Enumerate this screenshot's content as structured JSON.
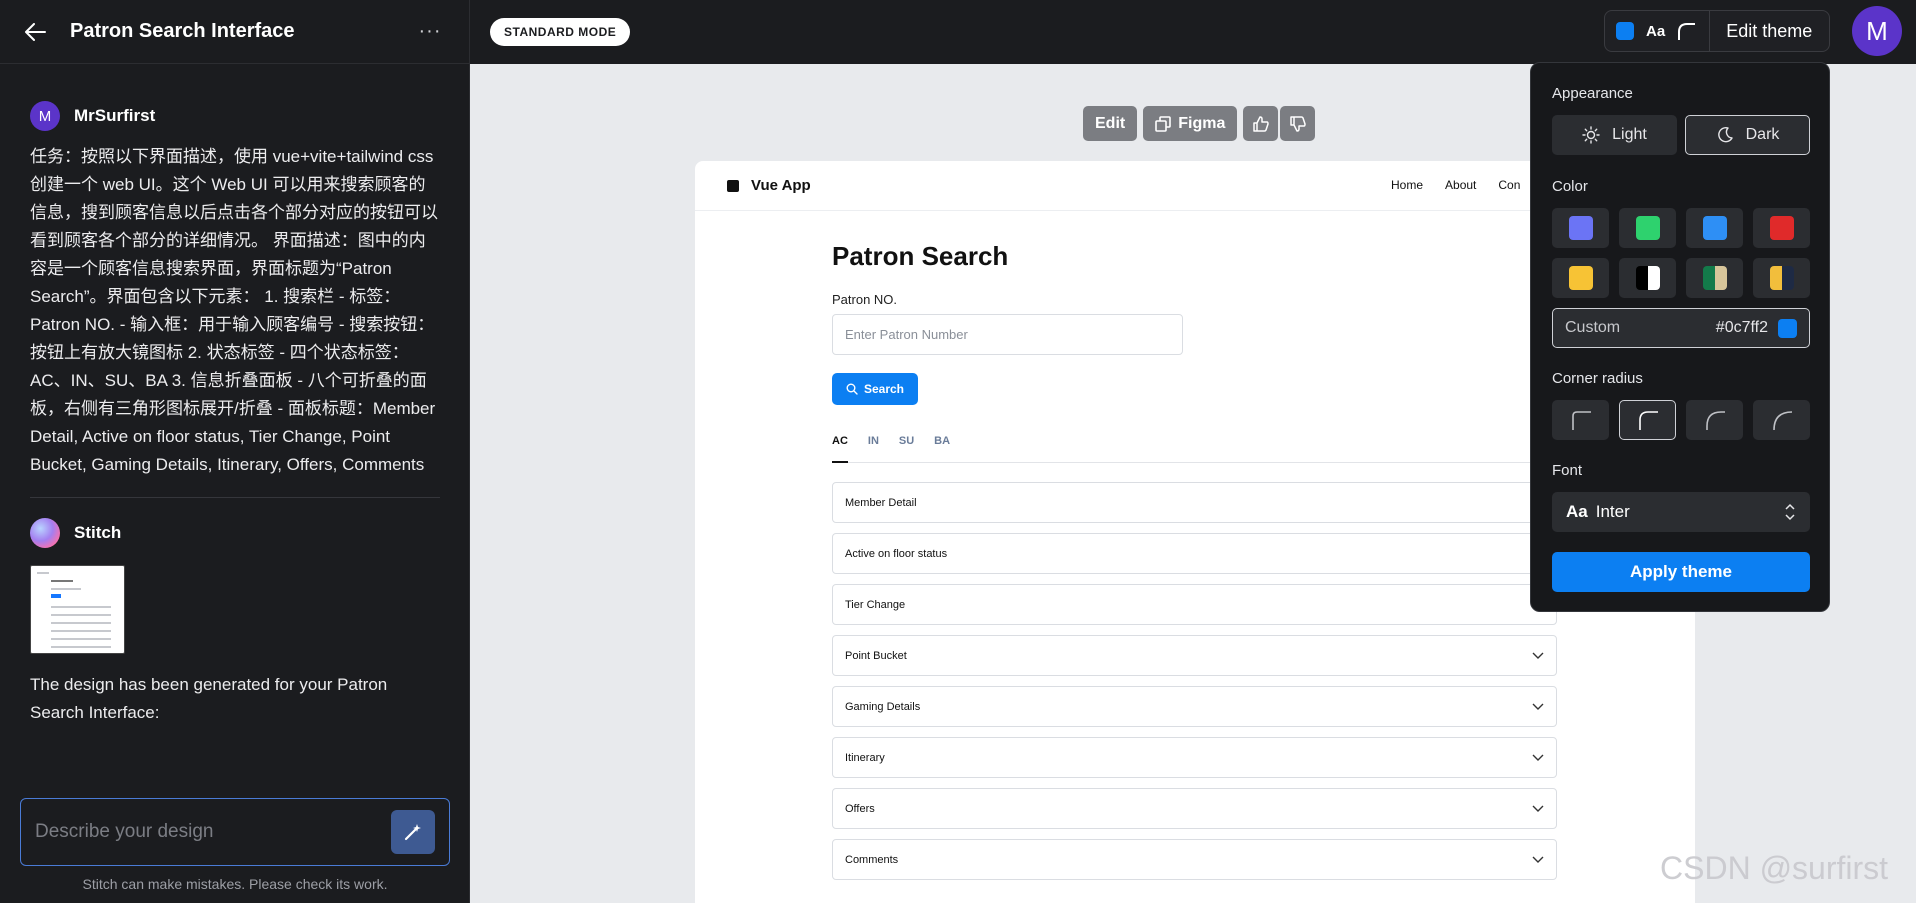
{
  "left_panel": {
    "title": "Patron Search Interface",
    "user": {
      "avatar_letter": "M",
      "name": "MrSurfirst"
    },
    "user_message": "任务：按照以下界面描述，使用 vue+vite+tailwind css 创建一个 web UI。这个 Web UI 可以用来搜索顾客的信息，搜到顾客信息以后点击各个部分对应的按钮可以看到顾客各个部分的详细情况。 界面描述：图中的内容是一个顾客信息搜索界面，界面标题为“Patron Search”。界面包含以下元素： 1. 搜索栏 - 标签：Patron NO. - 输入框：用于输入顾客编号 - 搜索按钮：按钮上有放大镜图标 2. 状态标签 - 四个状态标签：AC、IN、SU、BA 3. 信息折叠面板 - 八个可折叠的面板，右侧有三角形图标展开/折叠 - 面板标题：Member Detail, Active on floor status, Tier Change, Point Bucket, Gaming Details, Itinerary, Offers, Comments",
    "bot": {
      "name": "Stitch"
    },
    "bot_message": "The design has been generated for your Patron Search Interface:",
    "input_placeholder": "Describe your design",
    "disclaimer": "Stitch can make mistakes. Please check its work."
  },
  "topbar": {
    "mode": "STANDARD MODE",
    "theme_aa": "Aa",
    "edit_theme": "Edit theme",
    "avatar_letter": "M"
  },
  "canvas_toolbar": {
    "edit": "Edit",
    "figma": "Figma"
  },
  "app": {
    "name": "Vue App",
    "nav_links": [
      "Home",
      "About",
      "Con"
    ],
    "page_title": "Patron Search",
    "field_label": "Patron NO.",
    "input_placeholder": "Enter Patron Number",
    "search_label": "Search",
    "tabs": [
      "AC",
      "IN",
      "SU",
      "BA"
    ],
    "panels": [
      "Member Detail",
      "Active on floor status",
      "Tier Change",
      "Point Bucket",
      "Gaming Details",
      "Itinerary",
      "Offers",
      "Comments"
    ]
  },
  "theme_popover": {
    "appearance_label": "Appearance",
    "light": "Light",
    "dark": "Dark",
    "color_label": "Color",
    "colors": [
      "#6b74f5",
      "#2ed26e",
      "#2e8ff5",
      "#e02a2a",
      "#f7c335",
      "bw",
      "gg",
      "ynavy"
    ],
    "custom_label": "Custom",
    "custom_hex": "#0c7ff2",
    "corner_label": "Corner radius",
    "font_label": "Font",
    "font_aa": "Aa",
    "font_name": "Inter",
    "apply": "Apply theme"
  },
  "watermark": "CSDN @surfirst"
}
